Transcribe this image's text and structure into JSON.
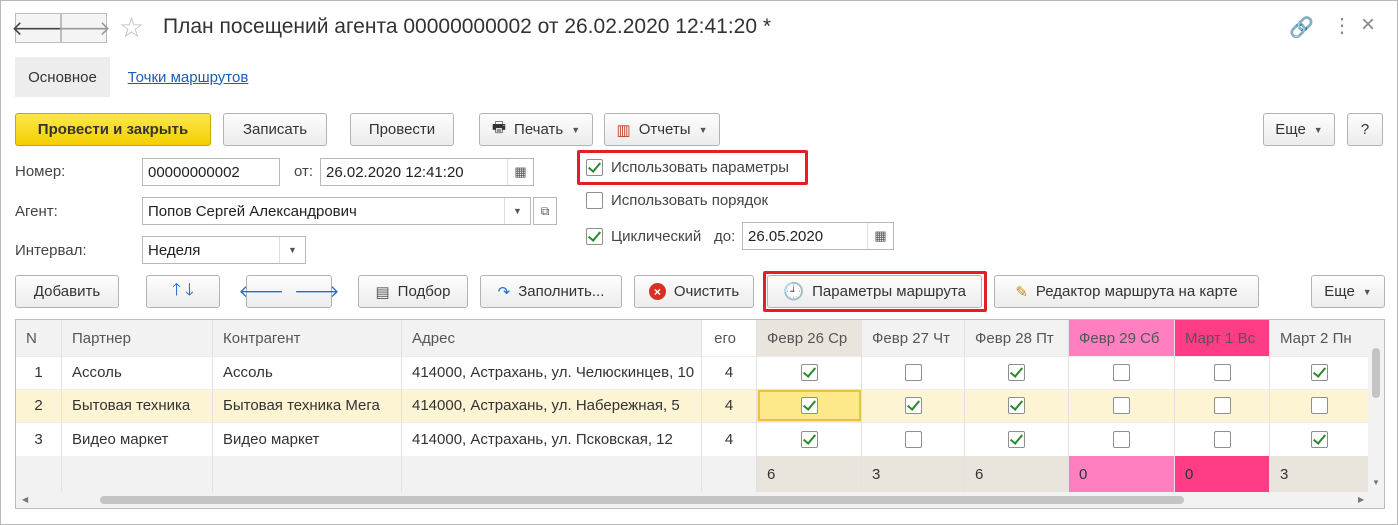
{
  "window": {
    "title": "План посещений агента 00000000002 от 26.02.2020 12:41:20 *",
    "back_icon": "arrow-left-icon",
    "forward_icon": "arrow-right-icon"
  },
  "tabs": [
    {
      "label": "Основное"
    },
    {
      "label": "Точки маршрутов"
    }
  ],
  "toolbar": {
    "post_close": "Провести и закрыть",
    "save": "Записать",
    "post": "Провести",
    "print": "Печать",
    "reports": "Отчеты",
    "more": "Еще",
    "help": "?"
  },
  "form": {
    "number_label": "Номер:",
    "number_value": "00000000002",
    "from_label": "от:",
    "date_value": "26.02.2020 12:41:20",
    "agent_label": "Агент:",
    "agent_value": "Попов Сергей Александрович",
    "interval_label": "Интервал:",
    "interval_value": "Неделя",
    "use_params_label": "Использовать параметры",
    "use_params_checked": true,
    "use_order_label": "Использовать порядок",
    "use_order_checked": false,
    "cyclic_label": "Циклический",
    "cyclic_checked": true,
    "until_label": "до:",
    "until_value": "26.05.2020"
  },
  "table_toolbar": {
    "add": "Добавить",
    "pick": "Подбор",
    "fill": "Заполнить...",
    "clear": "Очистить",
    "route_params": "Параметры маршрута",
    "map_editor": "Редактор маршрута на карте",
    "more": "Еще"
  },
  "table": {
    "columns": [
      "N",
      "Партнер",
      "Контрагент",
      "Адрес",
      "его"
    ],
    "day_columns": [
      {
        "label": "Февр 26 Ср",
        "bg": "#eae5dc",
        "total": "6"
      },
      {
        "label": "Февр 27 Чт",
        "bg": "#f2f2f2",
        "total": "3"
      },
      {
        "label": "Февр 28 Пт",
        "bg": "#f2f2f2",
        "total": "6"
      },
      {
        "label": "Февр 29 Сб",
        "bg": "#ff7fc0",
        "total": "0"
      },
      {
        "label": "Март 1 Вс",
        "bg": "#ff3d86",
        "total": "0"
      },
      {
        "label": "Март 2 Пн",
        "bg": "#f2f2f2",
        "total": "3"
      }
    ],
    "rows": [
      {
        "n": "1",
        "partner": "Ассоль",
        "counterparty": "Ассоль",
        "address": "414000, Астрахань, ул. Челюскинцев, 10",
        "count": "4",
        "days": [
          true,
          false,
          true,
          false,
          false,
          true
        ]
      },
      {
        "n": "2",
        "partner": "Бытовая техника",
        "counterparty": "Бытовая техника Мега",
        "address": "414000, Астрахань, ул. Набережная, 5",
        "count": "4",
        "days": [
          true,
          true,
          true,
          false,
          false,
          false
        ]
      },
      {
        "n": "3",
        "partner": "Видео маркет",
        "counterparty": "Видео маркет",
        "address": "414000, Астрахань, ул. Псковская, 12",
        "count": "4",
        "days": [
          true,
          false,
          true,
          false,
          false,
          true
        ]
      }
    ],
    "selected_row": 1
  },
  "colors": {
    "primary_button": "#f5d400",
    "highlight": "#e31e24",
    "link": "#1a5fb4"
  }
}
